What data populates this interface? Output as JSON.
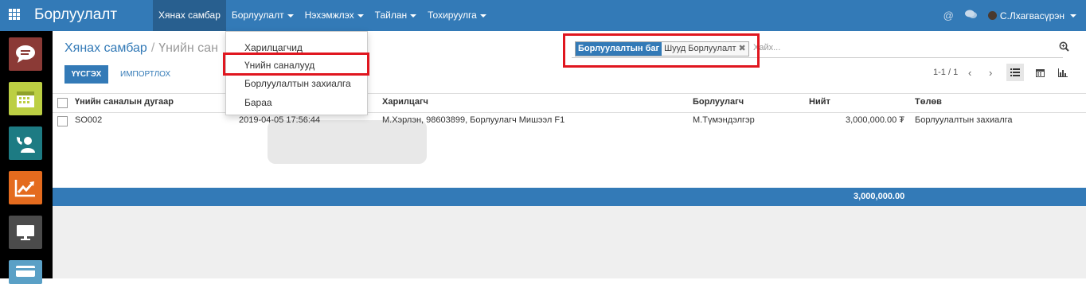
{
  "navbar": {
    "brand": "Борлуулалт",
    "menu": [
      {
        "label": "Хянах самбар",
        "dropdown": false
      },
      {
        "label": "Борлуулалт",
        "dropdown": true
      },
      {
        "label": "Нэхэмжлэх",
        "dropdown": true
      },
      {
        "label": "Тайлан",
        "dropdown": true
      },
      {
        "label": "Тохируулга",
        "dropdown": true
      }
    ],
    "user_name": "С.Лхагвасүрэн",
    "icons": [
      "apps-grid-icon",
      "at-icon",
      "chat-icon",
      "user-avatar"
    ]
  },
  "dock": {
    "apps": [
      {
        "icon": "chat-bubble-icon",
        "color": "#8b3a36"
      },
      {
        "icon": "calendar-icon",
        "color": "#bccf43"
      },
      {
        "icon": "phone-contact-icon",
        "color": "#1d7b83"
      },
      {
        "icon": "trend-chart-icon",
        "color": "#e46b1e"
      },
      {
        "icon": "monitor-icon",
        "color": "#4b4b4b"
      },
      {
        "icon": "card-icon",
        "color": "#5aa0c6"
      }
    ]
  },
  "breadcrumb": {
    "parent": "Хянах самбар",
    "separator": "/",
    "current": "Үнийн сан"
  },
  "buttons": {
    "create": "ҮҮСГЭХ",
    "import": "ИМПОРТЛОХ"
  },
  "search": {
    "facet_label": "Борлуулалтын баг",
    "facet_value": "Шууд Борлуулалт",
    "remove_glyph": "✖",
    "placeholder": "Хайх..."
  },
  "pager": {
    "range": "1-1 / 1",
    "prev": "‹",
    "next": "›"
  },
  "dropdown": {
    "items": [
      {
        "label": "Харилцагчид",
        "highlighted": false
      },
      {
        "label": "Үнийн саналууд",
        "highlighted": true
      },
      {
        "label": "Борлуулалтын захиалга",
        "highlighted": false
      },
      {
        "label": "Бараа",
        "highlighted": false
      }
    ]
  },
  "table": {
    "columns": [
      "Үнийн саналын дугаар",
      "",
      "Харилцагч",
      "Борлуулагч",
      "Нийт",
      "Төлөв"
    ],
    "rows": [
      {
        "number": "SO002",
        "date": "2019-04-05 17:56:44",
        "partner": "М.Хэрлэн, 98603899, Борлуулагч Мишээл F1",
        "salesperson": "М.Түмэндэлгэр",
        "total": "3,000,000.00 ₮",
        "status": "Борлуулалтын захиалга"
      }
    ],
    "footer_total": "3,000,000.00"
  },
  "colors": {
    "brand": "#337ab7",
    "highlight": "#e0161f"
  }
}
